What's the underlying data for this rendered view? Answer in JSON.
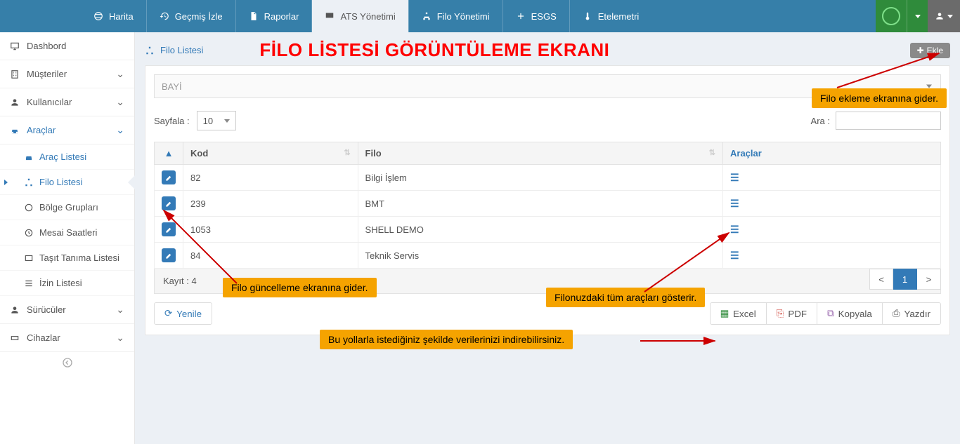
{
  "topnav": {
    "items": [
      {
        "label": "Harita"
      },
      {
        "label": "Geçmiş İzle"
      },
      {
        "label": "Raporlar"
      },
      {
        "label": "ATS Yönetimi"
      },
      {
        "label": "Filo Yönetimi"
      },
      {
        "label": "ESGS"
      },
      {
        "label": "Etelemetri"
      }
    ]
  },
  "sidebar": {
    "dashbord": "Dashbord",
    "musteriler": "Müşteriler",
    "kullanicilar": "Kullanıcılar",
    "araclar": "Araçlar",
    "arac_listesi": "Araç Listesi",
    "filo_listesi": "Filo Listesi",
    "bolge_gruplari": "Bölge Grupları",
    "mesai_saatleri": "Mesai Saatleri",
    "tasit_tanima": "Taşıt Tanıma Listesi",
    "izin_listesi": "İzin Listesi",
    "suruculer": "Sürücüler",
    "cihazlar": "Cihazlar"
  },
  "header": {
    "breadcrumb": "Filo Listesi",
    "overlay_title": "FİLO LİSTESİ GÖRÜNTÜLEME EKRANI",
    "add_button": "Ekle"
  },
  "filter": {
    "bayi_placeholder": "BAYİ"
  },
  "controls": {
    "sayfala_label": "Sayfala :",
    "sayfala_value": "10",
    "ara_label": "Ara :"
  },
  "table": {
    "headers": {
      "kod": "Kod",
      "filo": "Filo",
      "araclar": "Araçlar"
    },
    "rows": [
      {
        "kod": "82",
        "filo": "Bilgi İşlem"
      },
      {
        "kod": "239",
        "filo": "BMT"
      },
      {
        "kod": "1053",
        "filo": "SHELL DEMO"
      },
      {
        "kod": "84",
        "filo": "Teknik Servis"
      }
    ],
    "record_count_label": "Kayıt : 4"
  },
  "pager": {
    "prev": "<",
    "page": "1",
    "next": ">"
  },
  "actions": {
    "yenile": "Yenile",
    "excel": "Excel",
    "pdf": "PDF",
    "kopyala": "Kopyala",
    "yazdir": "Yazdır"
  },
  "callouts": {
    "c1": "Filo ekleme ekranına gider.",
    "c2": "Filo güncelleme ekranına gider.",
    "c3": "Filonuzdaki tüm araçları gösterir.",
    "c4": "Bu yollarla istediğiniz şekilde verilerinizi indirebilirsiniz."
  }
}
